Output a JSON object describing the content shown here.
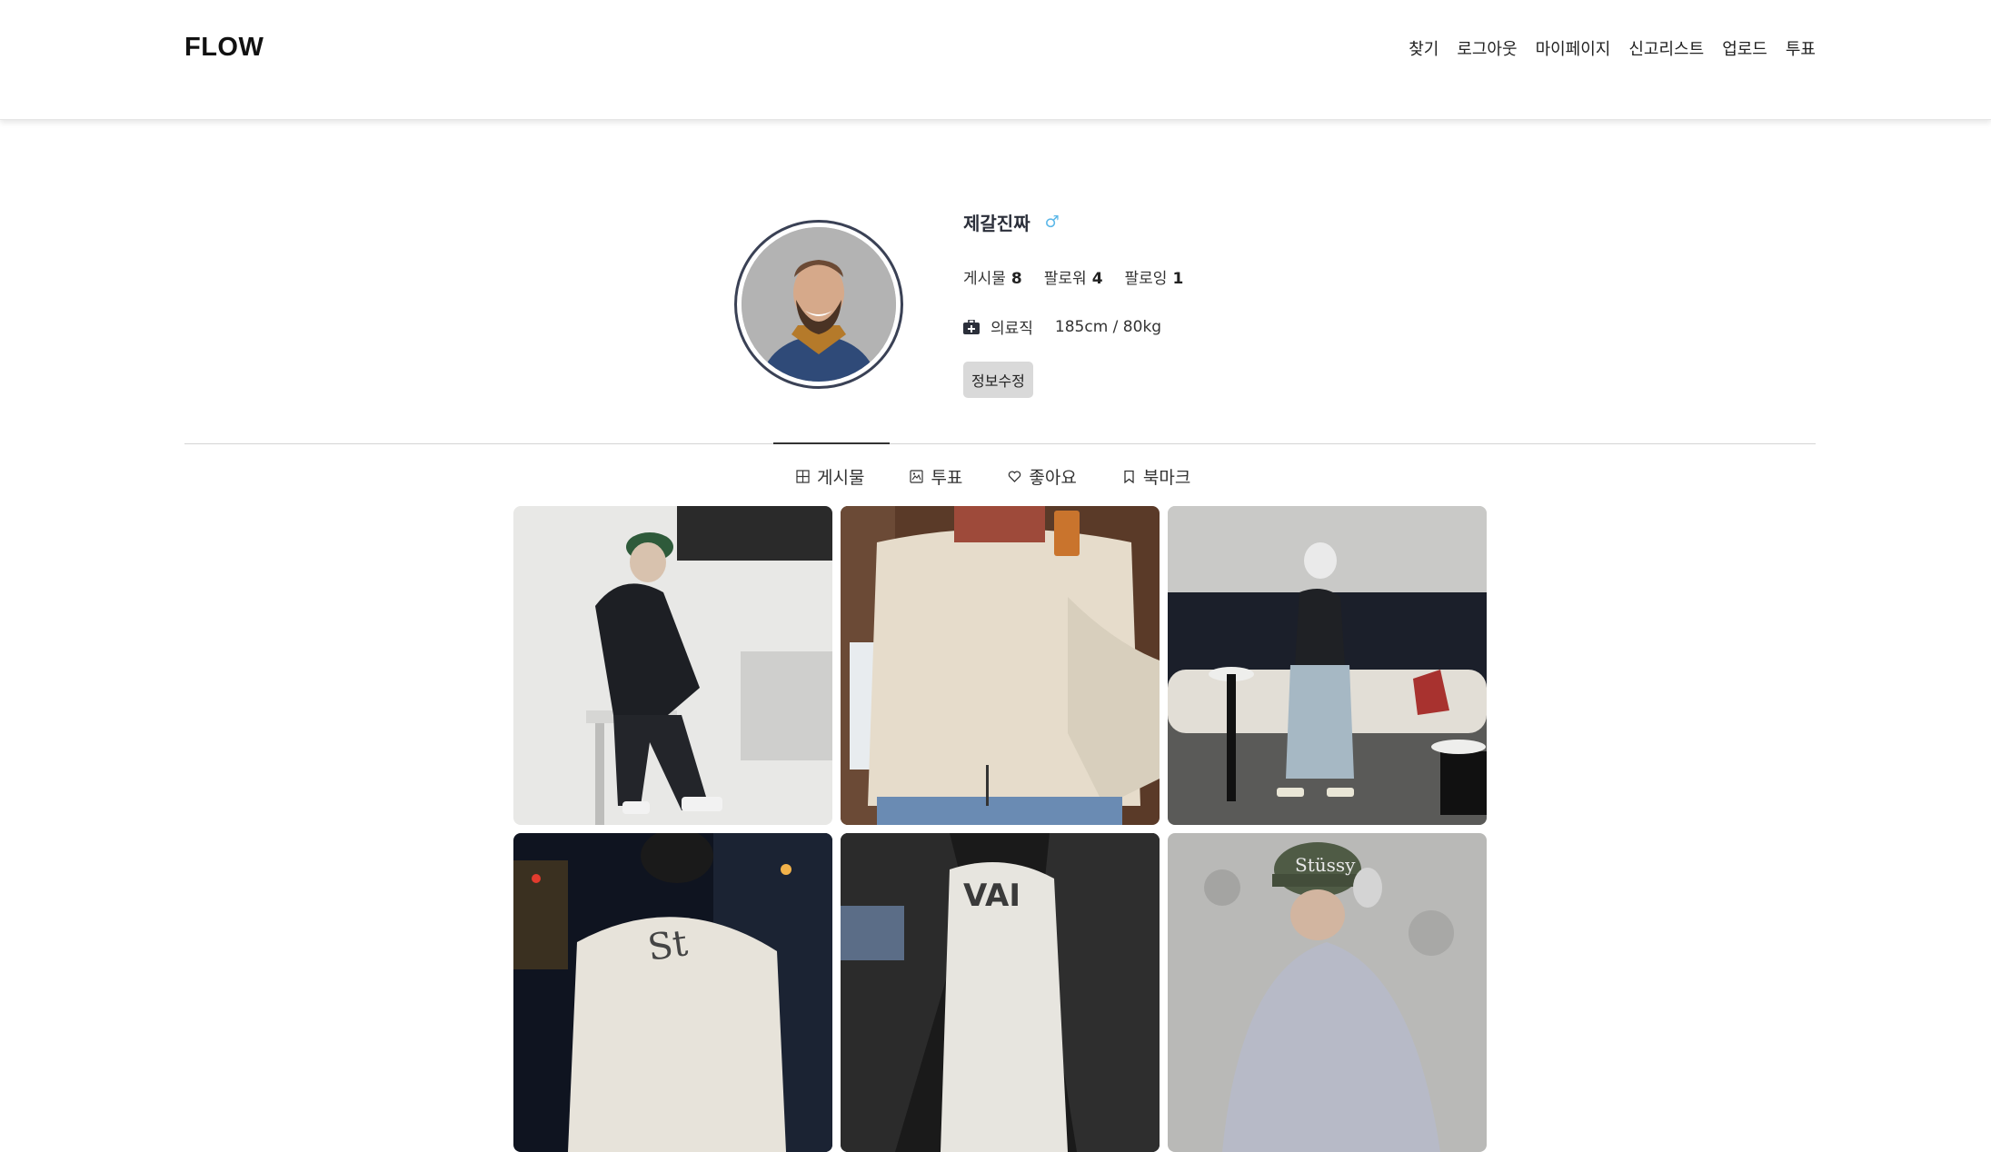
{
  "header": {
    "logo": "FLOW",
    "nav": [
      "찾기",
      "로그아웃",
      "마이페이지",
      "신고리스트",
      "업로드",
      "투표"
    ]
  },
  "profile": {
    "username": "제갈진짜",
    "gender_symbol": "♂",
    "stats": [
      {
        "label": "게시물",
        "value": "8"
      },
      {
        "label": "팔로워",
        "value": "4"
      },
      {
        "label": "팔로잉",
        "value": "1"
      }
    ],
    "job": "의료직",
    "body": "185cm / 80kg",
    "edit_label": "정보수정"
  },
  "tabs": [
    {
      "label": "게시물",
      "icon": "grid-icon",
      "active": true
    },
    {
      "label": "투표",
      "icon": "image-icon",
      "active": false
    },
    {
      "label": "좋아요",
      "icon": "heart-icon",
      "active": false
    },
    {
      "label": "북마크",
      "icon": "bookmark-icon",
      "active": false
    }
  ],
  "colors": {
    "accent": "#3a4155",
    "gender": "#5bb7e8",
    "edit_button_bg": "#d9d9d9"
  }
}
